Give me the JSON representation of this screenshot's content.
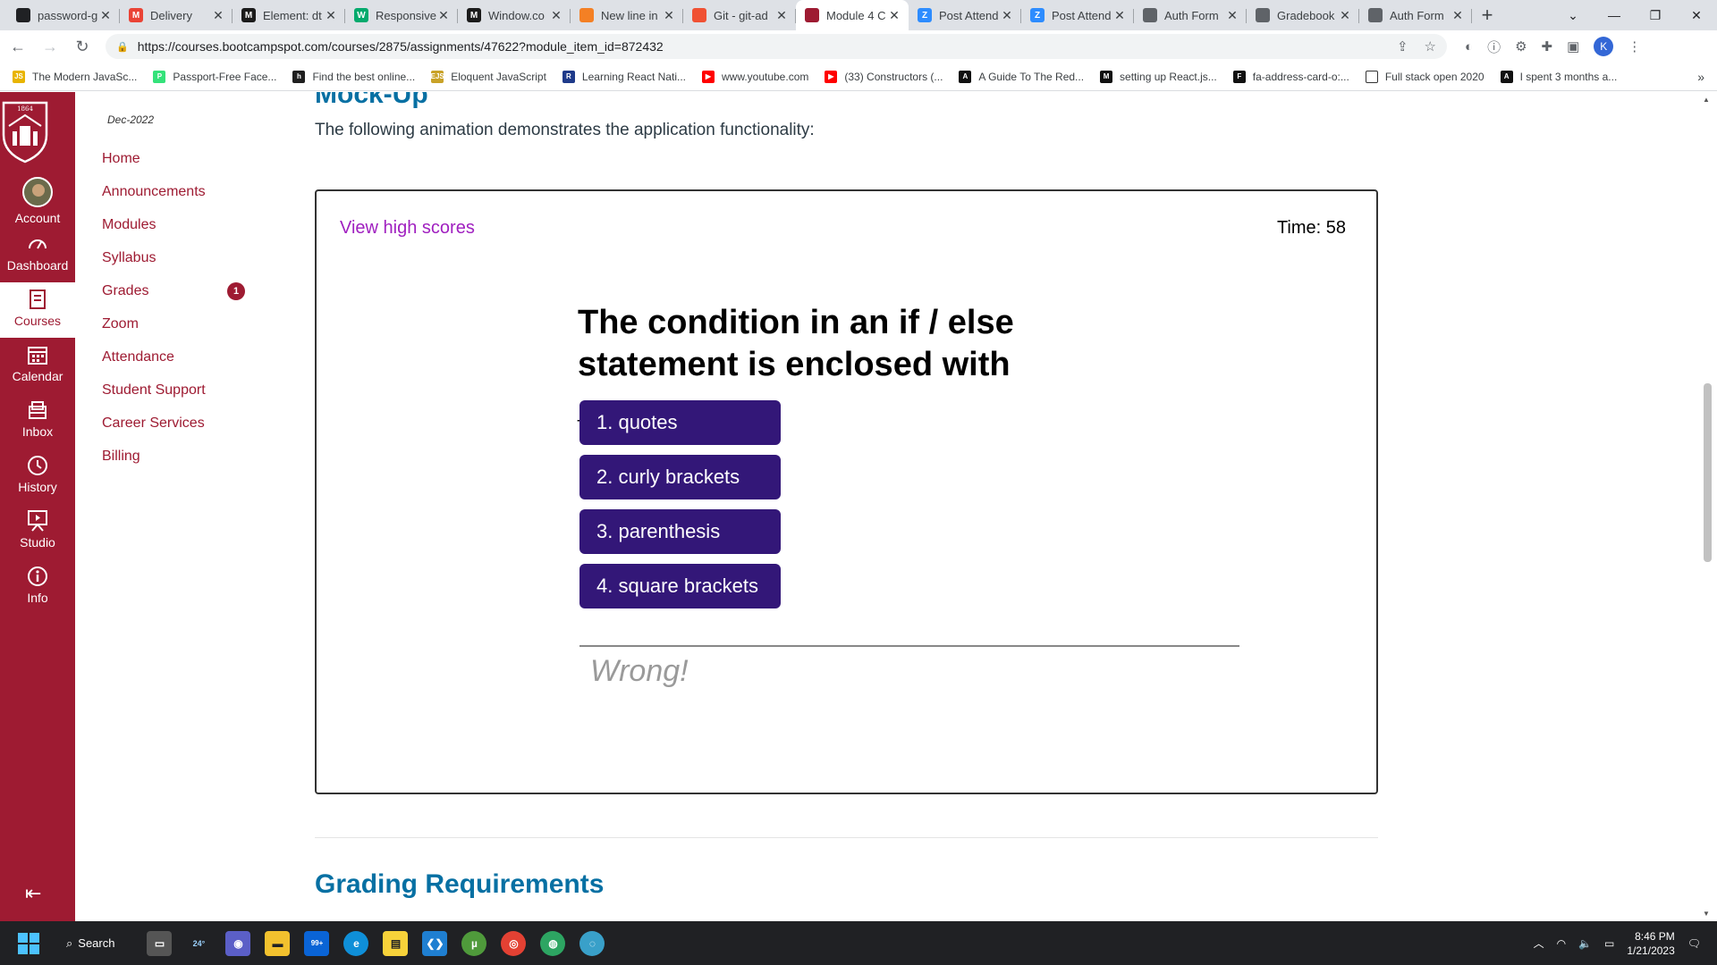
{
  "browser": {
    "tabs": [
      {
        "label": "password-g",
        "icon": "github-icon",
        "color": "#202124",
        "glyph": ""
      },
      {
        "label": "Delivery",
        "icon": "gmail-icon",
        "color": "#ea4335",
        "glyph": "M"
      },
      {
        "label": "Element: dt",
        "icon": "mdn-icon",
        "color": "#1b1b1b",
        "glyph": "M"
      },
      {
        "label": "Responsive",
        "icon": "w3schools-icon",
        "color": "#04aa6d",
        "glyph": "W"
      },
      {
        "label": "Window.co",
        "icon": "mdn-icon",
        "color": "#1b1b1b",
        "glyph": "M"
      },
      {
        "label": "New line in",
        "icon": "stackoverflow-icon",
        "color": "#f48024",
        "glyph": ""
      },
      {
        "label": "Git - git-ad",
        "icon": "git-icon",
        "color": "#f05133",
        "glyph": ""
      },
      {
        "label": "Module 4 C",
        "icon": "bootcamp-icon",
        "color": "#9e1b32",
        "glyph": "",
        "active": true
      },
      {
        "label": "Post Attend",
        "icon": "zoom-icon",
        "color": "#2d8cff",
        "glyph": "Z"
      },
      {
        "label": "Post Attend",
        "icon": "zoom-icon",
        "color": "#2d8cff",
        "glyph": "Z"
      },
      {
        "label": "Auth Form",
        "icon": "globe-icon",
        "color": "#5f6368",
        "glyph": ""
      },
      {
        "label": "Gradebook",
        "icon": "globe-icon",
        "color": "#5f6368",
        "glyph": ""
      },
      {
        "label": "Auth Form",
        "icon": "globe-icon",
        "color": "#5f6368",
        "glyph": ""
      }
    ],
    "url": "https://courses.bootcampspot.com/courses/2875/assignments/47622?module_item_id=872432",
    "profile_initial": "K",
    "bookmarks": [
      {
        "label": "The Modern JavaSc...",
        "color": "#e8b400",
        "glyph": "JS"
      },
      {
        "label": "Passport-Free Face...",
        "color": "#34e27a",
        "glyph": "P"
      },
      {
        "label": "Find the best online...",
        "color": "#1f1f1f",
        "glyph": "h"
      },
      {
        "label": "Eloquent JavaScript",
        "color": "#c9a227",
        "glyph": "EJS"
      },
      {
        "label": "Learning React Nati...",
        "color": "#1e3a8a",
        "glyph": "R"
      },
      {
        "label": "www.youtube.com",
        "color": "#ff0000",
        "glyph": "▶"
      },
      {
        "label": "(33) Constructors (...",
        "color": "#ff0000",
        "glyph": "▶"
      },
      {
        "label": "A Guide To The Red...",
        "color": "#111",
        "glyph": "A"
      },
      {
        "label": "setting up React.js...",
        "color": "#111",
        "glyph": "M"
      },
      {
        "label": "fa-address-card-o:...",
        "color": "#111",
        "glyph": "F"
      },
      {
        "label": "Full stack open 2020",
        "color": "#fff",
        "glyph": ""
      },
      {
        "label": "I spent 3 months a...",
        "color": "#111",
        "glyph": "A"
      }
    ],
    "bookmarks_more": "»"
  },
  "global_nav": {
    "items": [
      {
        "label": "Account",
        "icon": "account-avatar"
      },
      {
        "label": "Dashboard",
        "icon": "dashboard-icon"
      },
      {
        "label": "Courses",
        "icon": "courses-icon",
        "active": true
      },
      {
        "label": "Calendar",
        "icon": "calendar-icon"
      },
      {
        "label": "Inbox",
        "icon": "inbox-icon"
      },
      {
        "label": "History",
        "icon": "history-icon"
      },
      {
        "label": "Studio",
        "icon": "studio-icon"
      },
      {
        "label": "Info",
        "icon": "info-icon"
      }
    ],
    "collapse_icon": "collapse-icon"
  },
  "course_nav": {
    "term": "Dec-2022",
    "items": [
      {
        "label": "Home"
      },
      {
        "label": "Announcements"
      },
      {
        "label": "Modules"
      },
      {
        "label": "Syllabus"
      },
      {
        "label": "Grades",
        "badge": "1"
      },
      {
        "label": "Zoom"
      },
      {
        "label": "Attendance"
      },
      {
        "label": "Student Support"
      },
      {
        "label": "Career Services"
      },
      {
        "label": "Billing"
      }
    ]
  },
  "content": {
    "heading_partial": "Mock-Up",
    "intro": "The following animation demonstrates the application functionality:",
    "demo": {
      "high_scores_link": "View high scores",
      "timer": "Time: 58",
      "question": "The condition in an if / else statement is enclosed with ________.",
      "choices": [
        "1. quotes",
        "2. curly brackets",
        "3. parenthesis",
        "4. square brackets"
      ],
      "feedback": "Wrong!"
    },
    "next_heading": "Grading Requirements"
  },
  "taskbar": {
    "search_label": "Search",
    "weather": "24°",
    "mail_badge": "99+",
    "time": "8:46 PM",
    "date": "1/21/2023"
  },
  "colors": {
    "canvas_red": "#9e1b32",
    "heading_blue": "#0770a3",
    "choice_purple": "#331778",
    "link_purple": "#a020c0"
  }
}
